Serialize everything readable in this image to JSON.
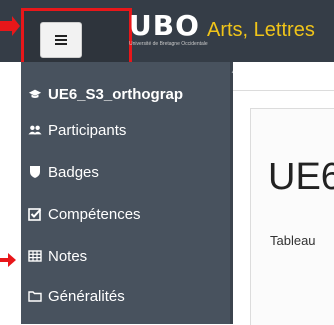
{
  "header": {
    "logo": "UBO",
    "logo_subtitle": "Université de Bretagne Occidentale",
    "site_name": "Arts, Lettres"
  },
  "sidebar": {
    "items": [
      {
        "label": "UE6_S3_orthograp",
        "icon": "graduation-cap-icon"
      },
      {
        "label": "Participants",
        "icon": "users-icon"
      },
      {
        "label": "Badges",
        "icon": "shield-icon"
      },
      {
        "label": "Compétences",
        "icon": "checkbox-icon"
      },
      {
        "label": "Notes",
        "icon": "table-icon"
      },
      {
        "label": "Généralités",
        "icon": "folder-icon"
      }
    ]
  },
  "main": {
    "heading": "UE6",
    "subtext": "Tableau"
  },
  "annotation": {
    "color": "#e8171a"
  },
  "colors": {
    "topbar": "#353d47",
    "sidebar": "#48525e",
    "accent": "#f0c419"
  }
}
